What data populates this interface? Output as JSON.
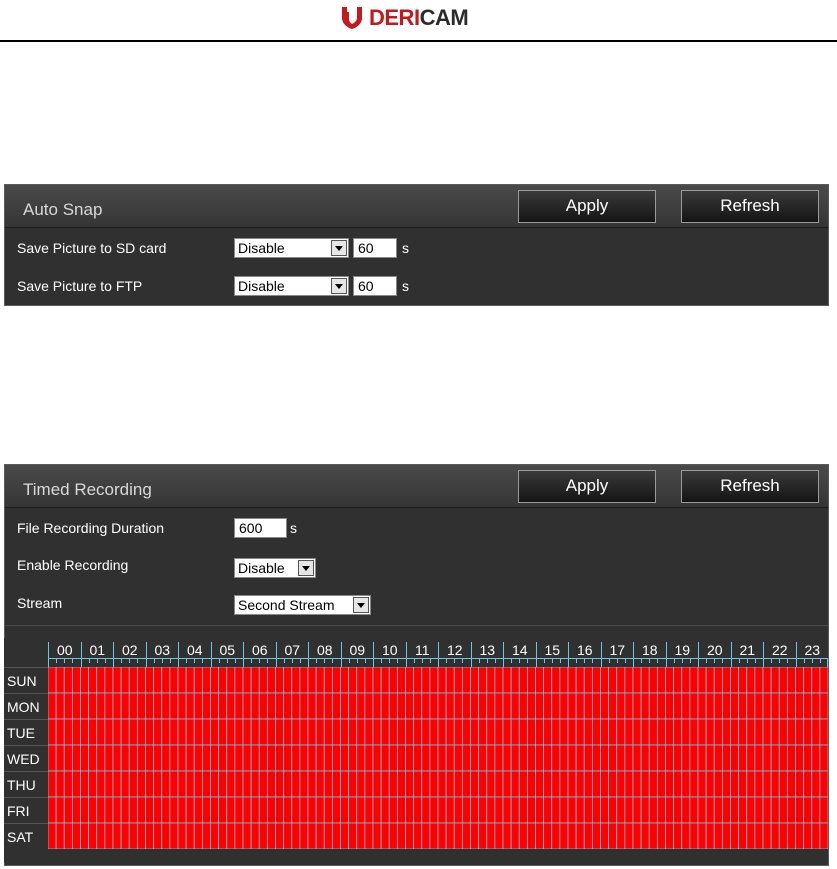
{
  "brand": {
    "name_part1": "DERI",
    "name_part2": "CAM"
  },
  "auto_snap": {
    "title": "Auto Snap",
    "apply_label": "Apply",
    "refresh_label": "Refresh",
    "rows": [
      {
        "label": "Save Picture to SD card",
        "selected": "Disable",
        "interval": "60",
        "unit": "s"
      },
      {
        "label": "Save Picture to FTP",
        "selected": "Disable",
        "interval": "60",
        "unit": "s"
      }
    ]
  },
  "timed_recording": {
    "title": "Timed Recording",
    "apply_label": "Apply",
    "refresh_label": "Refresh",
    "duration_label": "File Recording Duration",
    "duration_value": "600",
    "duration_unit": "s",
    "enable_label": "Enable Recording",
    "enable_value": "Disable",
    "stream_label": "Stream",
    "stream_value": "Second Stream"
  },
  "schedule": {
    "hours": [
      "00",
      "01",
      "02",
      "03",
      "04",
      "05",
      "06",
      "07",
      "08",
      "09",
      "10",
      "11",
      "12",
      "13",
      "14",
      "15",
      "16",
      "17",
      "18",
      "19",
      "20",
      "21",
      "22",
      "23"
    ],
    "days": [
      "SUN",
      "MON",
      "TUE",
      "WED",
      "THU",
      "FRI",
      "SAT"
    ],
    "slots_per_hour": 4,
    "all_selected": true,
    "selected_color": "#ff0000",
    "grid_line_color": "#6ec5e4"
  }
}
